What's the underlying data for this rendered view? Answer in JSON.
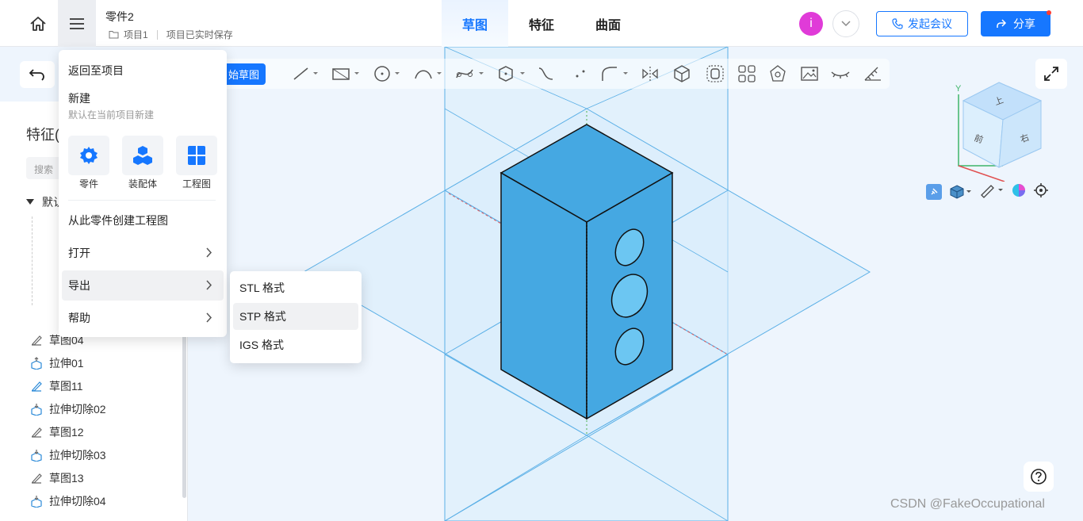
{
  "header": {
    "doc_title": "零件2",
    "project": "项目1",
    "save_status": "项目已实时保存",
    "tabs": [
      "草图",
      "特征",
      "曲面"
    ],
    "avatar_letter": "i",
    "meeting_label": "发起会议",
    "share_label": "分享"
  },
  "toolbar": {
    "start_sketch": "始草图"
  },
  "panel": {
    "title": "特征(",
    "search_placeholder": "搜索",
    "tree_group": "默认",
    "tree_items": [
      "草图04",
      "拉伸01",
      "草图11",
      "拉伸切除02",
      "草图12",
      "拉伸切除03",
      "草图13",
      "拉伸切除04"
    ]
  },
  "file_menu": {
    "back": "返回至项目",
    "new": "新建",
    "new_hint": "默认在当前项目新建",
    "cards": [
      "零件",
      "装配体",
      "工程图"
    ],
    "create_drawing": "从此零件创建工程图",
    "open": "打开",
    "export": "导出",
    "help": "帮助"
  },
  "export_submenu": [
    "STL 格式",
    "STP 格式",
    "IGS 格式"
  ],
  "view_cube": {
    "top": "上",
    "front": "前",
    "right": "右",
    "axis_y": "Y"
  },
  "watermark": "CSDN @FakeOccupational",
  "colors": {
    "accent": "#1677ff",
    "part_fill": "#45a8e2",
    "plane": "#d9ecfb"
  }
}
